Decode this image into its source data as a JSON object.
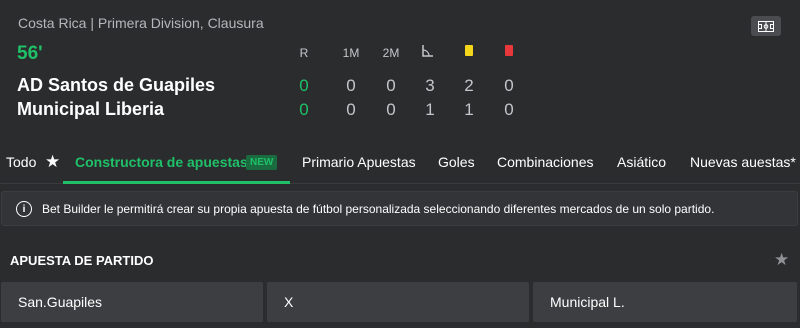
{
  "match": {
    "league": "Costa Rica | Primera Division, Clausura",
    "minute": "56'",
    "columns": {
      "r": "R",
      "first_half": "1M",
      "second_half": "2M"
    },
    "home": {
      "name": "AD Santos de Guapiles",
      "score": "0",
      "first_half": "0",
      "second_half": "0",
      "corners": "3",
      "yellow": "2",
      "red": "0"
    },
    "away": {
      "name": "Municipal Liberia",
      "score": "0",
      "first_half": "0",
      "second_half": "0",
      "corners": "1",
      "yellow": "1",
      "red": "0"
    },
    "icons": {
      "stats": "scoreboard-icon",
      "corners": "corner-flag-icon",
      "yellow": "yellow-card-icon",
      "red": "red-card-icon"
    },
    "colors": {
      "live": "#1fc068",
      "yellow_card": "#f4d71b",
      "red_card": "#e8383b"
    }
  },
  "tabs": {
    "all": "Todo",
    "builder": "Constructora de apuestas",
    "builder_badge": "NEW",
    "primary": "Primario Apuestas",
    "goals": "Goles",
    "combinations": "Combinaciones",
    "asian": "Asiático",
    "new_bets": "Nuevas auestas*"
  },
  "info": {
    "text": "Bet Builder le permitirá crear su propia apuesta de fútbol personalizada seleccionando diferentes mercados de un solo partido."
  },
  "market": {
    "title": "APUESTA DE PARTIDO",
    "outcomes": [
      "San.Guapiles",
      "X",
      "Municipal L."
    ]
  }
}
